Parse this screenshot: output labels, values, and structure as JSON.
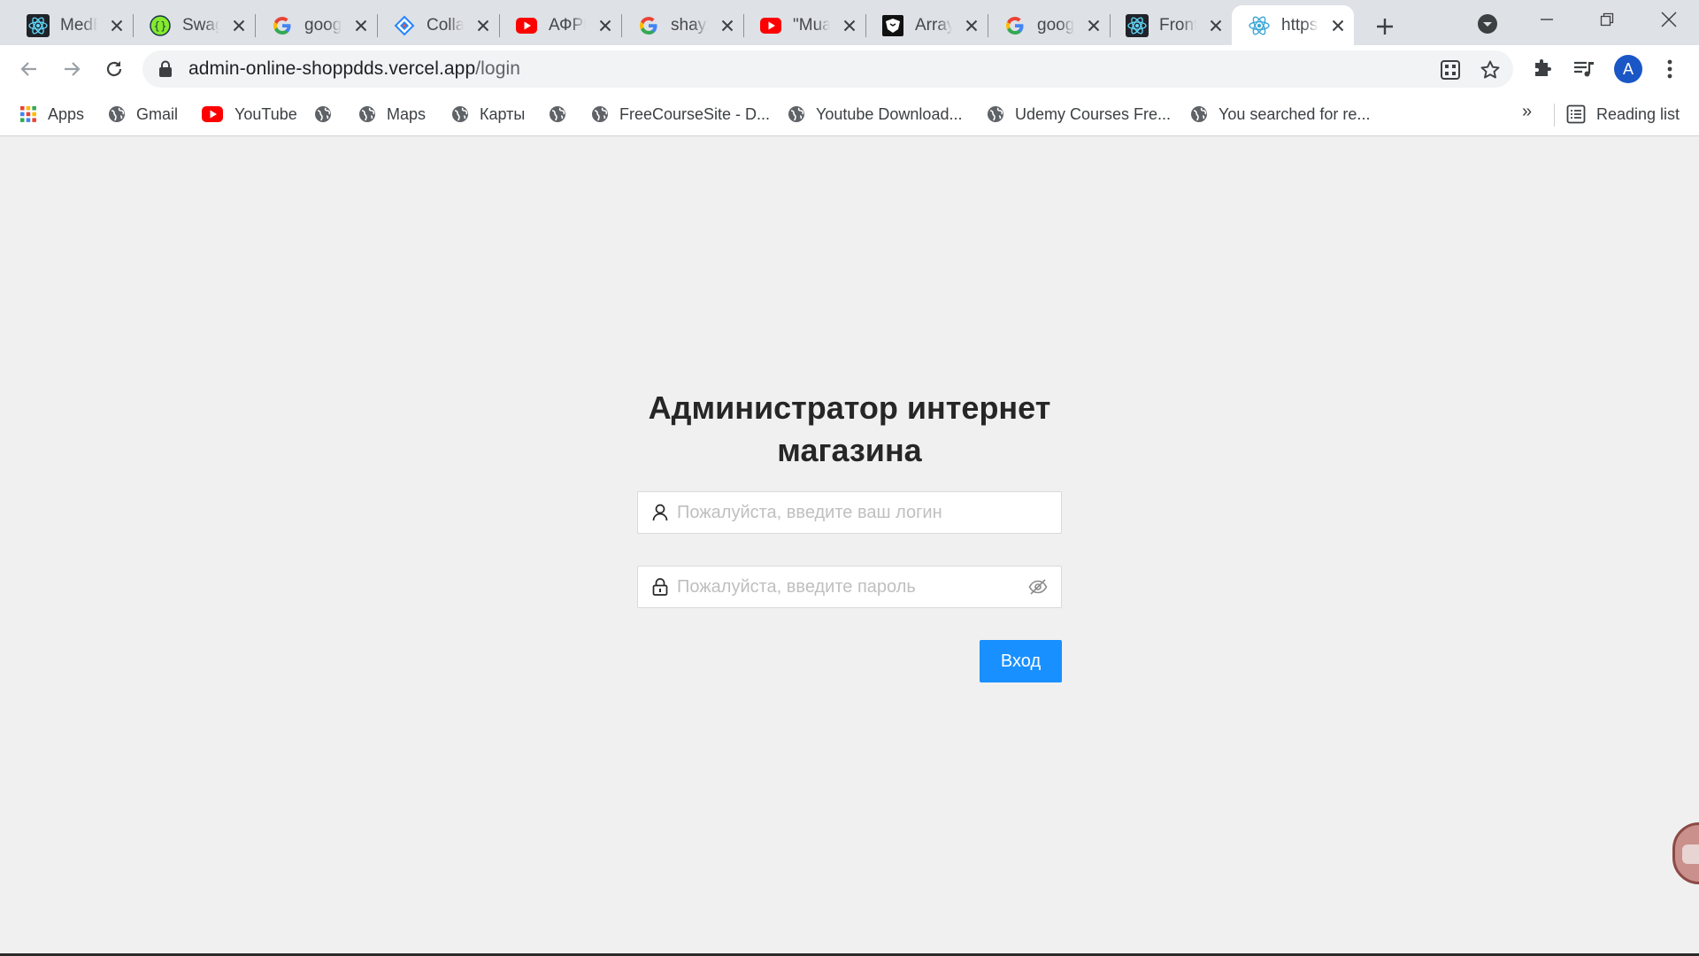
{
  "browser": {
    "tabs": [
      {
        "title": "MedBook",
        "icon": "react-icon",
        "active": false
      },
      {
        "title": "Swagger UI",
        "icon": "swagger-icon",
        "active": false
      },
      {
        "title": "google",
        "icon": "google-icon",
        "active": false
      },
      {
        "title": "Collab",
        "icon": "jira-icon",
        "active": false
      },
      {
        "title": "АФРИКА",
        "icon": "youtube-icon",
        "active": false
      },
      {
        "title": "shayx",
        "icon": "google-icon",
        "active": false
      },
      {
        "title": "\"Muallim\"",
        "icon": "youtube-icon",
        "active": false
      },
      {
        "title": "Array",
        "icon": "codewars-icon",
        "active": false
      },
      {
        "title": "google",
        "icon": "google-icon",
        "active": false
      },
      {
        "title": "Front",
        "icon": "react-icon",
        "active": false
      },
      {
        "title": "https",
        "icon": "react-icon",
        "active": true
      }
    ],
    "address": {
      "host": "admin-online-shoppdds.vercel.app",
      "path": "/login"
    },
    "profile_initial": "A",
    "bookmarks": [
      {
        "label": "Apps",
        "icon": "apps-grid-icon"
      },
      {
        "label": "Gmail",
        "icon": "globe-icon"
      },
      {
        "label": "YouTube",
        "icon": "youtube-icon"
      },
      {
        "label": "",
        "icon": "globe-icon"
      },
      {
        "label": "Maps",
        "icon": "globe-icon"
      },
      {
        "label": "Карты",
        "icon": "globe-icon"
      },
      {
        "label": "",
        "icon": "globe-icon"
      },
      {
        "label": "FreeCourseSite - D...",
        "icon": "globe-icon"
      },
      {
        "label": "Youtube Download...",
        "icon": "globe-icon"
      },
      {
        "label": "Udemy Courses Fre...",
        "icon": "globe-icon"
      },
      {
        "label": "You searched for re...",
        "icon": "globe-icon"
      }
    ],
    "bookmarks_more": "»",
    "reading_list": "Reading list"
  },
  "login": {
    "title": "Администратор интернет магазина",
    "username_placeholder": "Пожалуйста, введите ваш логин",
    "password_placeholder": "Пожалуйста, введите пароль",
    "submit_label": "Вход"
  },
  "colors": {
    "primary_button": "#1890ff",
    "page_background": "#f0f0f0",
    "tabstrip": "#dee1e6"
  }
}
